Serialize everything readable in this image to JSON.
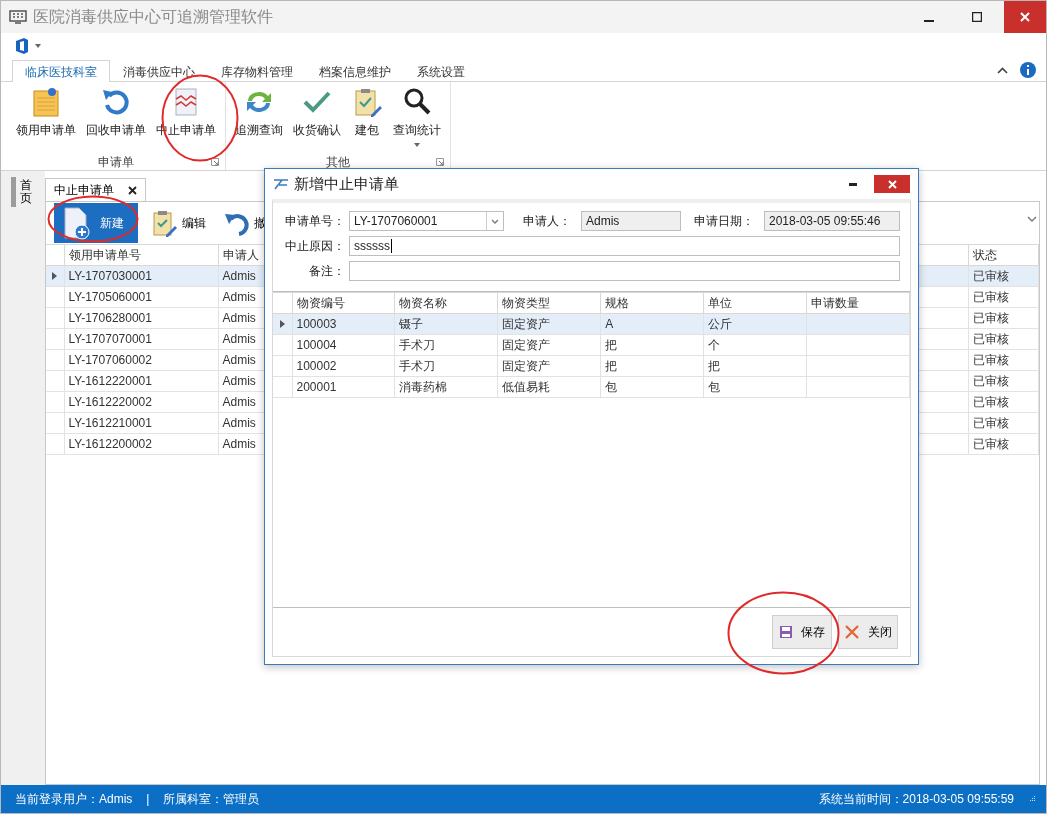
{
  "window": {
    "title": "医院消毒供应中心可追溯管理软件"
  },
  "ribbon": {
    "tabs": [
      {
        "label": "临床医技科室",
        "selected": true
      },
      {
        "label": "消毒供应中心",
        "selected": false
      },
      {
        "label": "库存物料管理",
        "selected": false
      },
      {
        "label": "档案信息维护",
        "selected": false
      },
      {
        "label": "系统设置",
        "selected": false
      }
    ],
    "groups": [
      {
        "label": "申请单",
        "buttons": [
          {
            "label": "领用申请单",
            "dropdown": false
          },
          {
            "label": "回收申请单",
            "dropdown": false
          },
          {
            "label": "中止申请单",
            "dropdown": false
          }
        ]
      },
      {
        "label": "其他",
        "buttons": [
          {
            "label": "追溯查询",
            "dropdown": false
          },
          {
            "label": "收货确认",
            "dropdown": false
          },
          {
            "label": "建包",
            "dropdown": false
          },
          {
            "label": "查询统计",
            "dropdown": true
          }
        ]
      }
    ]
  },
  "side_tabs": [
    {
      "label": "首页"
    }
  ],
  "document_tabs": [
    {
      "label": "中止申请单",
      "selected": true
    }
  ],
  "toolbar": [
    {
      "label": "新建",
      "kind": "primary"
    },
    {
      "label": "编辑",
      "kind": "plain"
    },
    {
      "label": "撤",
      "kind": "plain"
    }
  ],
  "table": {
    "columns": [
      "领用申请单号",
      "申请人",
      "状态"
    ],
    "rows": [
      {
        "cells": [
          "LY-1707030001",
          "Admis",
          "已审核"
        ],
        "selected": true
      },
      {
        "cells": [
          "LY-1705060001",
          "Admis",
          "已审核"
        ],
        "selected": false
      },
      {
        "cells": [
          "LY-1706280001",
          "Admis",
          "已审核"
        ],
        "selected": false
      },
      {
        "cells": [
          "LY-1707070001",
          "Admis",
          "已审核"
        ],
        "selected": false
      },
      {
        "cells": [
          "LY-1707060002",
          "Admis",
          "已审核"
        ],
        "selected": false
      },
      {
        "cells": [
          "LY-1612220001",
          "Admis",
          "已审核"
        ],
        "selected": false
      },
      {
        "cells": [
          "LY-1612220002",
          "Admis",
          "已审核"
        ],
        "selected": false
      },
      {
        "cells": [
          "LY-1612210001",
          "Admis",
          "已审核"
        ],
        "selected": false
      },
      {
        "cells": [
          "LY-1612200002",
          "Admis",
          "已审核"
        ],
        "selected": false
      }
    ]
  },
  "dialog": {
    "title": "新增中止申请单",
    "request_no": {
      "label": "申请单号：",
      "value": "LY-1707060001"
    },
    "applicant": {
      "label": "申请人：",
      "value": "Admis"
    },
    "date": {
      "label": "申请日期：",
      "value": "2018-03-05 09:55:46"
    },
    "reason": {
      "label": "中止原因：",
      "value": "ssssss"
    },
    "remark": {
      "label": "备注："
    },
    "grid": {
      "columns": [
        "物资编号",
        "物资名称",
        "物资类型",
        "规格",
        "单位",
        "申请数量"
      ],
      "rows": [
        {
          "cells": [
            "100003",
            "镊子",
            "固定资产",
            "A",
            "公斤"
          ],
          "selected": true
        },
        {
          "cells": [
            "100004",
            "手术刀",
            "固定资产",
            "把",
            "个"
          ],
          "selected": false
        },
        {
          "cells": [
            "100002",
            "手术刀",
            "固定资产",
            "把",
            "把"
          ],
          "selected": false
        },
        {
          "cells": [
            "200001",
            "消毒药棉",
            "低值易耗",
            "包",
            "包"
          ],
          "selected": false
        }
      ]
    },
    "buttons": [
      {
        "label": "保存",
        "kind": "save"
      },
      {
        "label": "关闭",
        "kind": "close"
      }
    ]
  },
  "status_bar": {
    "user": "当前登录用户：Admis",
    "separator": "|",
    "department": "所属科室：管理员",
    "time": "系统当前时间：2018-03-05 09:55:59"
  }
}
